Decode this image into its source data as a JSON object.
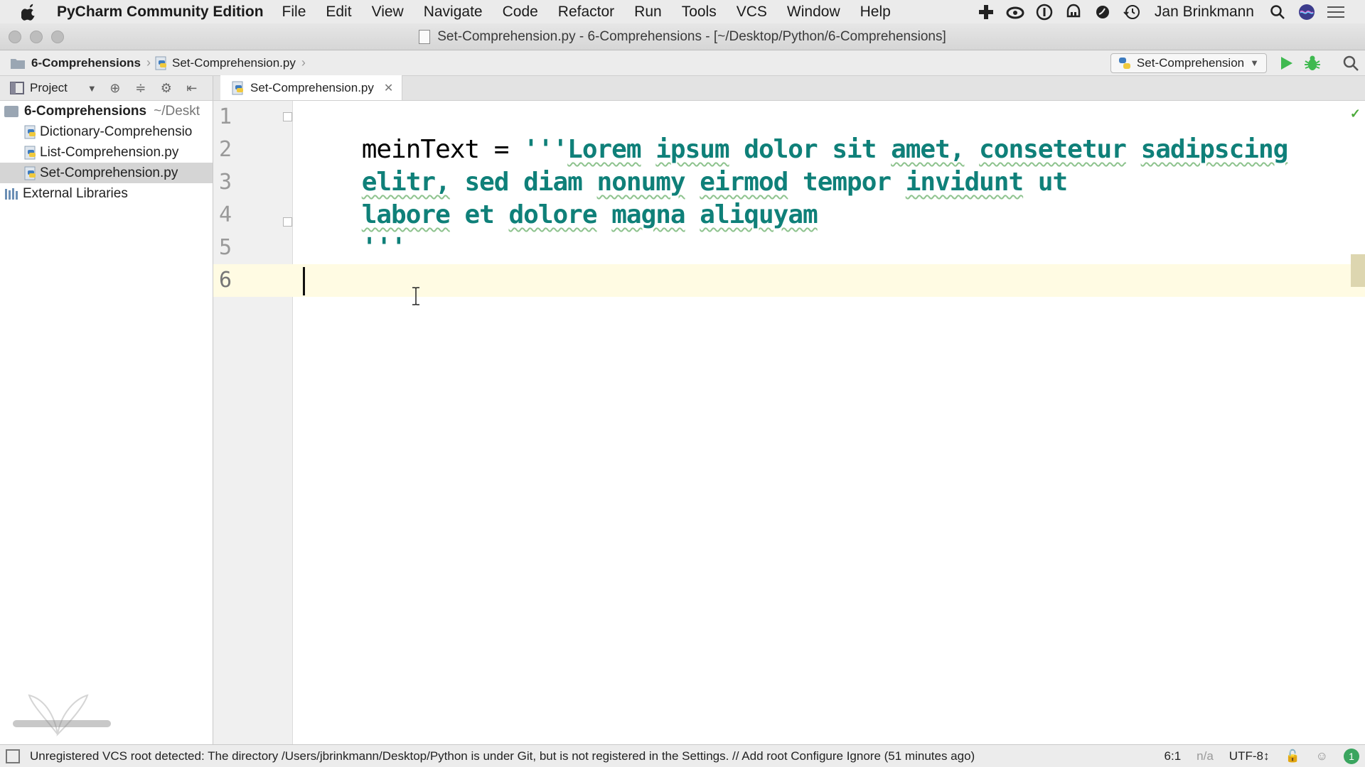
{
  "menubar": {
    "app_name": "PyCharm Community Edition",
    "items": [
      "File",
      "Edit",
      "View",
      "Navigate",
      "Code",
      "Refactor",
      "Run",
      "Tools",
      "VCS",
      "Window",
      "Help"
    ],
    "user": "Jan Brinkmann",
    "tray_icons": [
      "add-icon",
      "creative-cloud-icon",
      "password-manager-icon",
      "notification-icon",
      "vpn-icon",
      "time-machine-icon",
      "spotlight-search-icon",
      "siri-icon",
      "notification-center-icon"
    ]
  },
  "window": {
    "title": "Set-Comprehension.py - 6-Comprehensions - [~/Desktop/Python/6-Comprehensions]"
  },
  "navbar": {
    "breadcrumb": [
      "6-Comprehensions",
      "Set-Comprehension.py"
    ],
    "run_config": "Set-Comprehension"
  },
  "project": {
    "header": "Project",
    "root_name": "6-Comprehensions",
    "root_path": "~/Deskt",
    "files": [
      "Dictionary-Comprehensio",
      "List-Comprehension.py",
      "Set-Comprehension.py"
    ],
    "selected": "Set-Comprehension.py",
    "external": "External Libraries"
  },
  "editor": {
    "tab": "Set-Comprehension.py",
    "line_numbers": [
      "1",
      "2",
      "3",
      "4",
      "5",
      "6"
    ],
    "line1_var": "meinText = ",
    "line1_str_open": "'''",
    "line1_words": [
      "Lorem",
      "ipsum",
      "dolor",
      "sit",
      "amet,",
      "consetetur",
      "sadipscing"
    ],
    "line2_words": [
      "elitr,",
      "sed",
      "diam",
      "nonumy",
      "eirmod",
      "tempor",
      "invidunt",
      "ut"
    ],
    "line3_words": [
      "labore",
      "et",
      "dolore",
      "magna",
      "aliquyam"
    ],
    "line4": "'''"
  },
  "status": {
    "message": "Unregistered VCS root detected: The directory /Users/jbrinkmann/Desktop/Python is under Git, but is not registered in the Settings. // Add root  Configure  Ignore (51 minutes ago)",
    "position": "6:1",
    "na": "n/a",
    "encoding": "UTF-8↕",
    "badge": "1"
  },
  "colors": {
    "string": "#0f8079",
    "caret_line": "#fffbe3",
    "run_green": "#3fb950"
  }
}
